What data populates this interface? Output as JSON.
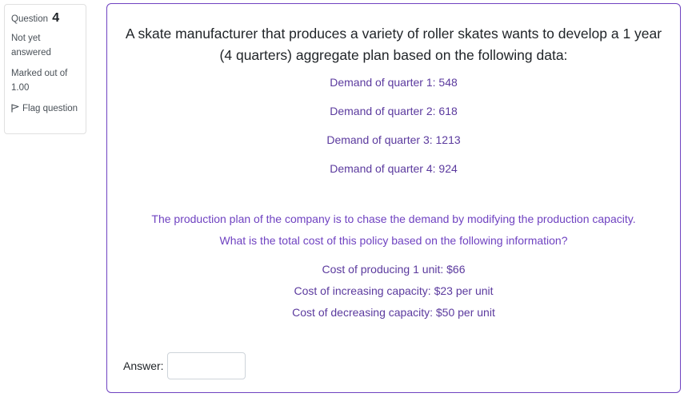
{
  "question_info": {
    "question_word": "Question",
    "question_number": "4",
    "state": "Not yet answered",
    "grade": "Marked out of 1.00",
    "flag_label": "Flag question",
    "flag_icon": "flag-icon"
  },
  "question": {
    "title": "A skate manufacturer that produces a variety of roller skates wants to develop a 1 year (4 quarters) aggregate plan based on the following data:",
    "demands": [
      "Demand of quarter 1: 548",
      "Demand of quarter 2: 618",
      "Demand of quarter 3: 1213",
      "Demand of quarter 4: 924"
    ],
    "plan_line1": "The production plan of the company is to chase the demand by modifying the production capacity.",
    "plan_line2": "What is the total cost of this policy based on the following information?",
    "costs": [
      "Cost of producing 1 unit: $66",
      "Cost of increasing capacity: $23 per unit",
      "Cost of decreasing capacity: $50 per unit"
    ],
    "answer_label": "Answer:",
    "answer_value": ""
  },
  "colors": {
    "accent": "#6f42c1",
    "text": "#212529"
  }
}
